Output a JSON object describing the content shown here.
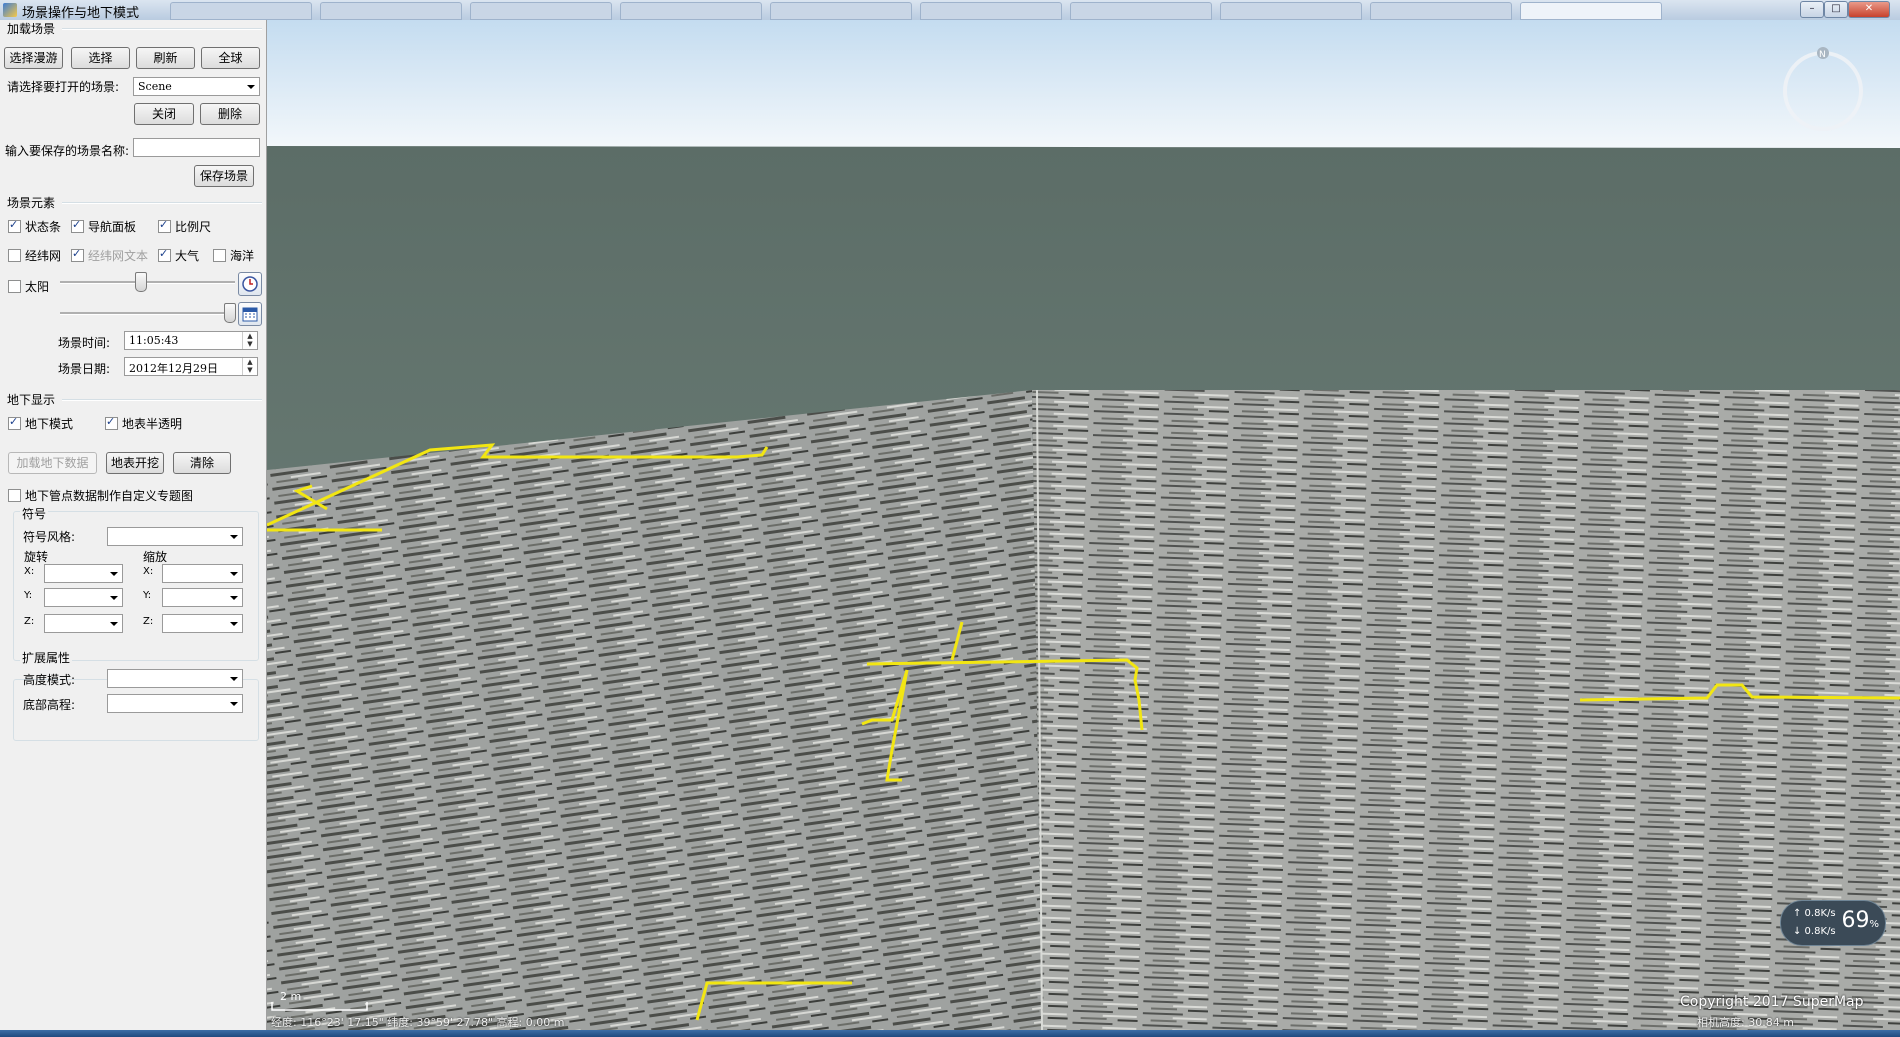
{
  "window": {
    "title": "场景操作与地下模式",
    "min_glyph": "–",
    "max_glyph": "□",
    "close_glyph": "✕"
  },
  "load_scene": {
    "group_label": "加载场景",
    "browse_button": "选择漫游",
    "select_button": "选择",
    "refresh_button": "刷新",
    "globe_button": "全球",
    "choose_label": "请选择要打开的场景:",
    "scene_value": "Scene",
    "close_button": "关闭",
    "delete_button": "删除",
    "save_name_label": "输入要保存的场景名称:",
    "save_name_value": "",
    "save_button": "保存场景"
  },
  "scene_elements": {
    "group_label": "场景元素",
    "status_bar": {
      "label": "状态条",
      "checked": true
    },
    "nav_panel": {
      "label": "导航面板",
      "checked": true
    },
    "scale_bar": {
      "label": "比例尺",
      "checked": true
    },
    "graticule": {
      "label": "经纬网",
      "checked": false
    },
    "graticule_text": {
      "label": "经纬网文本",
      "checked": true
    },
    "atmosphere": {
      "label": "大气",
      "checked": true
    },
    "ocean": {
      "label": "海洋",
      "checked": false
    },
    "sun": {
      "label": "太阳",
      "checked": false
    },
    "time_label": "场景时间:",
    "time_value": "11:05:43",
    "date_label": "场景日期:",
    "date_value": "2012年12月29日"
  },
  "underground": {
    "group_label": "地下显示",
    "mode": {
      "label": "地下模式",
      "checked": true
    },
    "translucent": {
      "label": "地表半透明",
      "checked": true
    },
    "load_button": "加载地下数据",
    "excavate_button": "地表开挖",
    "clear_button": "清除",
    "thematic": {
      "label": "地下管点数据制作自定义专题图",
      "checked": false
    }
  },
  "symbol": {
    "group_label": "符号",
    "style_label": "符号风格:",
    "rotate_label": "旋转",
    "scale_label": "缩放",
    "x_label": "X:",
    "y_label": "Y:",
    "z_label": "Z:"
  },
  "extended": {
    "group_label": "扩展属性",
    "height_mode_label": "高度模式:",
    "bottom_alt_label": "底部高程:"
  },
  "viewport": {
    "copyright": "Copyright 2017 SuperMap",
    "compass_north": "N",
    "scale_text": "2 m",
    "status_text": "经度: 116°23' 17.15\"   纬度: 39°59' 27.78\"   高程: 0.00 m",
    "camera_text": "相机高度: 30.84 m"
  },
  "speed_widget": {
    "up": "↑ 0.8K/s",
    "down": "↓ 0.8K/s",
    "percent": "69",
    "percent_unit": "%"
  },
  "colors": {
    "pipe": "#f2e612",
    "sky_top": "#c9dff0",
    "ground": "#6f8079"
  }
}
